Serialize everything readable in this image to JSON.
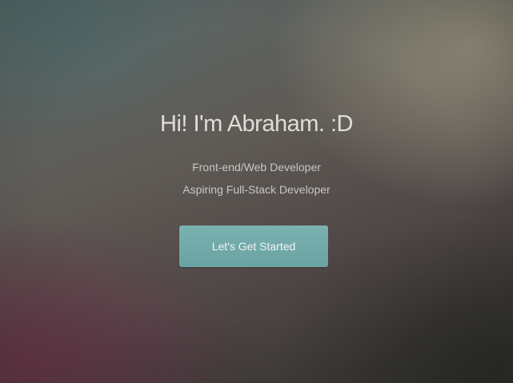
{
  "hero": {
    "title": "Hi! I'm Abraham. :D",
    "subtitle_1": "Front-end/Web Developer",
    "subtitle_2": "Aspiring Full-Stack Developer",
    "cta_label": "Let's Get Started"
  },
  "colors": {
    "button": "#72aaaa",
    "text": "#ebe8e4"
  }
}
